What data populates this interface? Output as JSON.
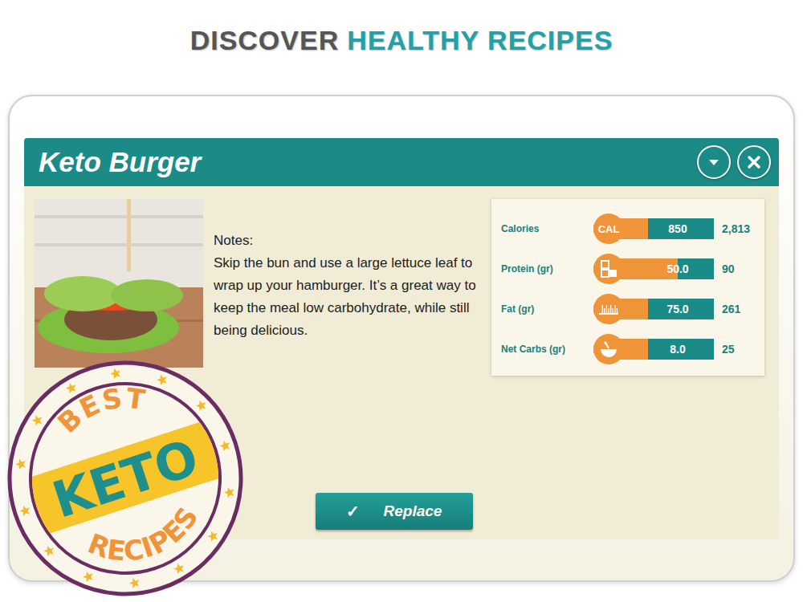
{
  "headline": {
    "dark": "DISCOVER",
    "accent": "HEALTHY RECIPES"
  },
  "recipe": {
    "title": "Keto Burger",
    "notes_label": "Notes:",
    "notes": "Skip the bun and use a large lettuce leaf to wrap up your hamburger. It’s a great way to keep the meal low carbohydrate, while still being delicious."
  },
  "nutrition": [
    {
      "label": "Calories",
      "kind": "text",
      "icon_text": "CAL",
      "value": "850",
      "target": "2,813",
      "level": 0.45
    },
    {
      "label": "Protein (gr)",
      "kind": "cubes",
      "value": "50.0",
      "target": "90",
      "level": 0.7
    },
    {
      "label": "Fat (gr)",
      "kind": "ruler",
      "value": "75.0",
      "target": "261",
      "level": 0.45
    },
    {
      "label": "Net Carbs (gr)",
      "kind": "gauge",
      "value": "8.0",
      "target": "25",
      "level": 0.45
    }
  ],
  "replace_button": {
    "icon": "✓",
    "label": "Replace"
  },
  "badge": {
    "top": "BEST",
    "middle": "KETO",
    "bottom": "RECIPES"
  }
}
